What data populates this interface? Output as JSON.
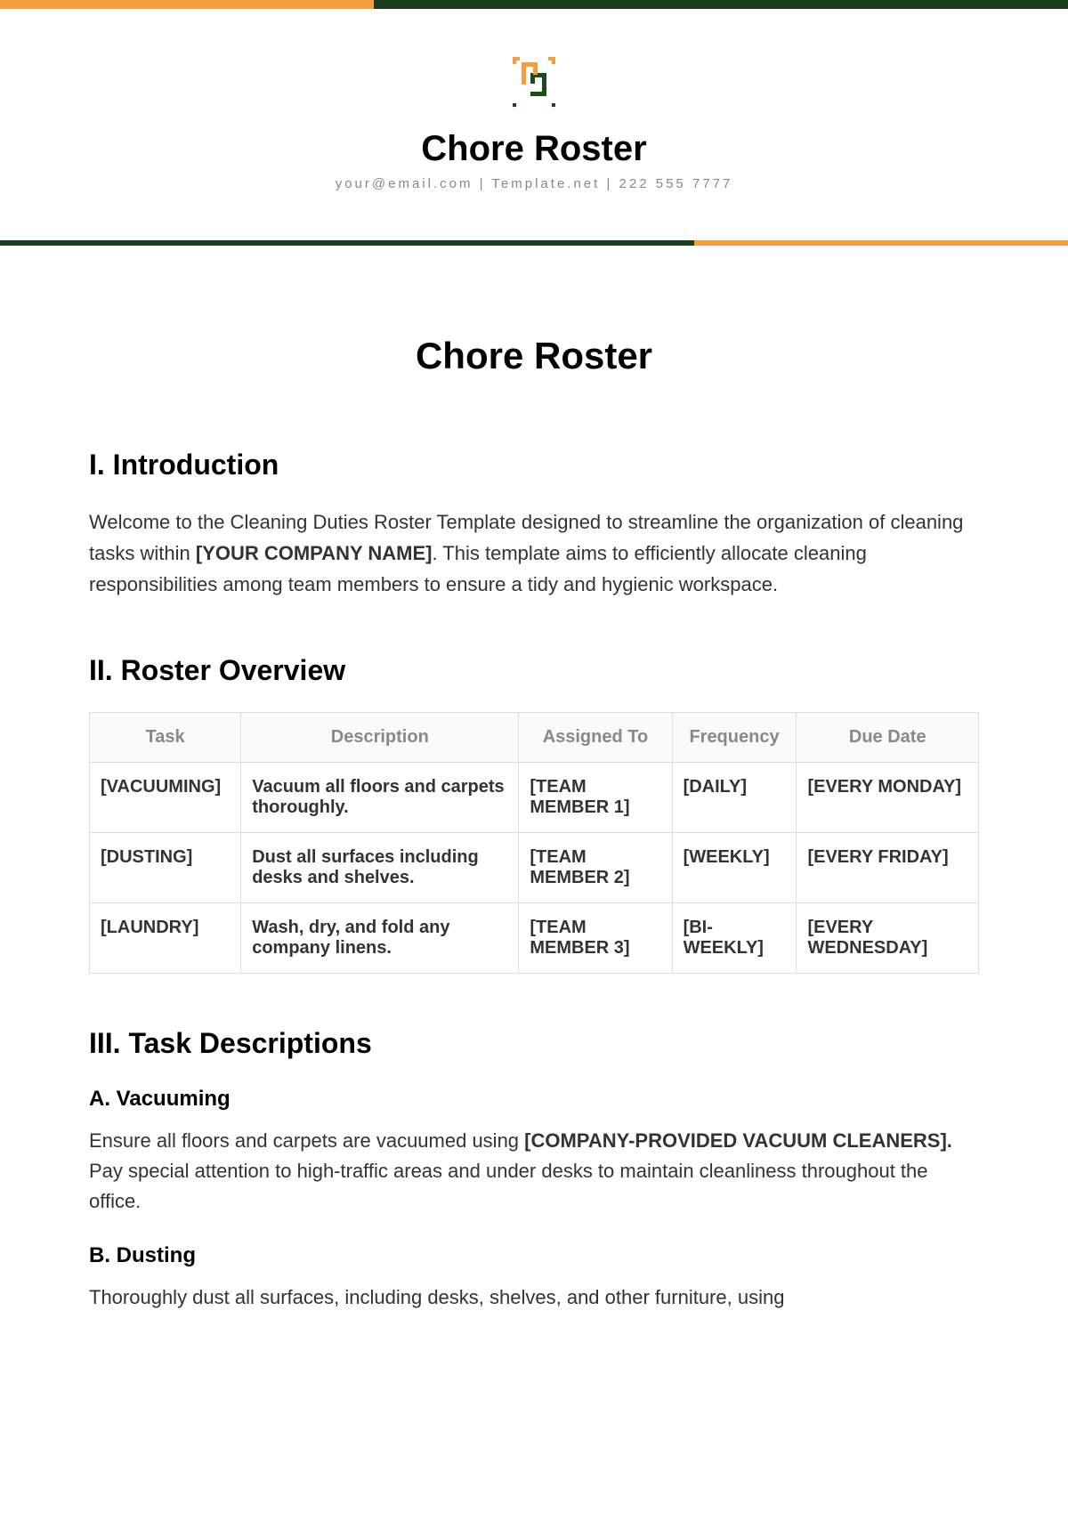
{
  "header": {
    "brandTitle": "Chore Roster",
    "brandSub": "your@email.com | Template.net | 222 555 7777"
  },
  "docTitle": "Chore Roster",
  "section1": {
    "heading": "I. Introduction",
    "textBefore": "Welcome to the Cleaning Duties Roster Template designed to streamline the organization of cleaning tasks within ",
    "textBold": "[YOUR COMPANY NAME]",
    "textAfter": ". This template aims to efficiently allocate cleaning responsibilities among team members to ensure a tidy and hygienic workspace."
  },
  "section2": {
    "heading": "II. Roster Overview",
    "columns": [
      "Task",
      "Description",
      "Assigned To",
      "Frequency",
      "Due Date"
    ],
    "rows": [
      {
        "task": "[VACUUMING]",
        "desc": "Vacuum all floors and carpets thoroughly.",
        "assigned": "[TEAM MEMBER 1]",
        "freq": "[DAILY]",
        "due": "[EVERY MONDAY]"
      },
      {
        "task": "[DUSTING]",
        "desc": "Dust all surfaces including desks and shelves.",
        "assigned": "[TEAM MEMBER 2]",
        "freq": "[WEEKLY]",
        "due": "[EVERY FRIDAY]"
      },
      {
        "task": "[LAUNDRY]",
        "desc": "Wash, dry, and fold any company linens.",
        "assigned": "[TEAM MEMBER 3]",
        "freq": "[BI-WEEKLY]",
        "due": "[EVERY WEDNESDAY]"
      }
    ]
  },
  "section3": {
    "heading": "III. Task Descriptions",
    "tasks": [
      {
        "title": "A. Vacuuming",
        "before": "Ensure all floors and carpets are vacuumed using ",
        "bold": "[COMPANY-PROVIDED VACUUM CLEANERS].",
        "after": " Pay special attention to high-traffic areas and under desks to maintain cleanliness throughout the office."
      },
      {
        "title": "B. Dusting",
        "before": "Thoroughly dust all surfaces, including desks, shelves, and other furniture, using",
        "bold": "",
        "after": ""
      }
    ]
  }
}
